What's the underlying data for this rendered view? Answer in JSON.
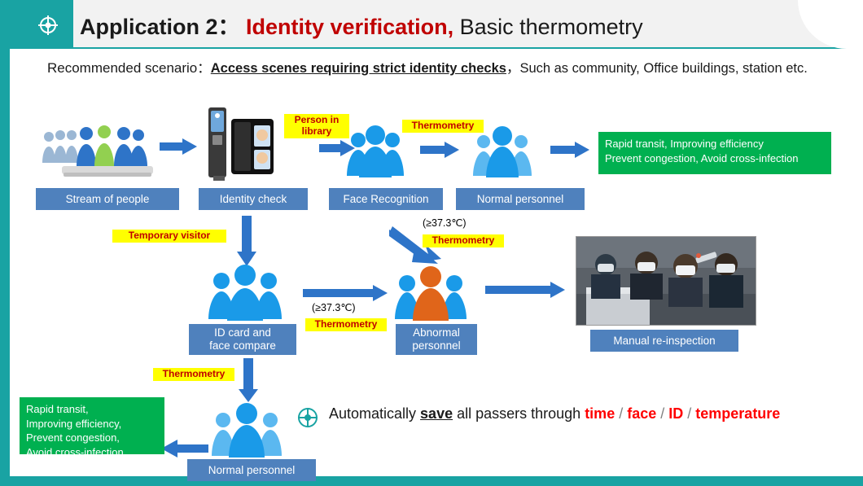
{
  "header": {
    "icon": "target-icon",
    "prefix": "Application 2",
    "colon": "：",
    "highlight": "Identity verification,",
    "suffix": " Basic thermometry"
  },
  "recommended": {
    "label": "Recommended scenario",
    "colon": "：",
    "emphasis": "Access scenes requiring strict identity checks",
    "tail": "，Such as community, Office buildings, station etc."
  },
  "flow": {
    "stream_of_people": "Stream of people",
    "identity_check": "Identity check",
    "person_in_library": "Person in library",
    "face_recognition": "Face Recognition",
    "thermometry_1": "Thermometry",
    "normal_personnel_1": "Normal personnel",
    "note_green_top_line1": "Rapid transit, Improving efficiency",
    "note_green_top_line2": "Prevent congestion, Avoid cross-infection",
    "temporary_visitor": "Temporary visitor",
    "id_card_and_face_compare_line1": "ID card and",
    "id_card_and_face_compare_line2": "face compare",
    "temp_threshold_left": "(≥37.3℃)",
    "thermometry_2": "Thermometry",
    "temp_threshold_mid": "(≥37.3℃)",
    "thermometry_3": "Thermometry",
    "abnormal_personnel_line1": "Abnormal",
    "abnormal_personnel_line2": "personnel",
    "manual_reinspection": "Manual re-inspection",
    "thermometry_4": "Thermometry",
    "normal_personnel_2": "Normal personnel",
    "note_green_bottom_line1": "Rapid transit,",
    "note_green_bottom_line2": "Improving efficiency,",
    "note_green_bottom_line3": "Prevent congestion,",
    "note_green_bottom_line4": "Avoid cross-infection."
  },
  "bottom": {
    "icon": "target-icon",
    "pre": "Automatically ",
    "save": "save",
    "mid": " all passers through ",
    "time": "time",
    "sep1": " / ",
    "face": "face",
    "sep2": " / ",
    "id": "ID",
    "sep3": " / ",
    "temperature": "temperature"
  },
  "colors": {
    "teal": "#19a3a3",
    "blue_box": "#4f81bd",
    "arrow_blue": "#2e74c8",
    "green": "#00b050",
    "yellow": "#ffff00",
    "red": "#c00000",
    "person_blue": "#1a9ae8",
    "person_orange": "#e0651a"
  }
}
